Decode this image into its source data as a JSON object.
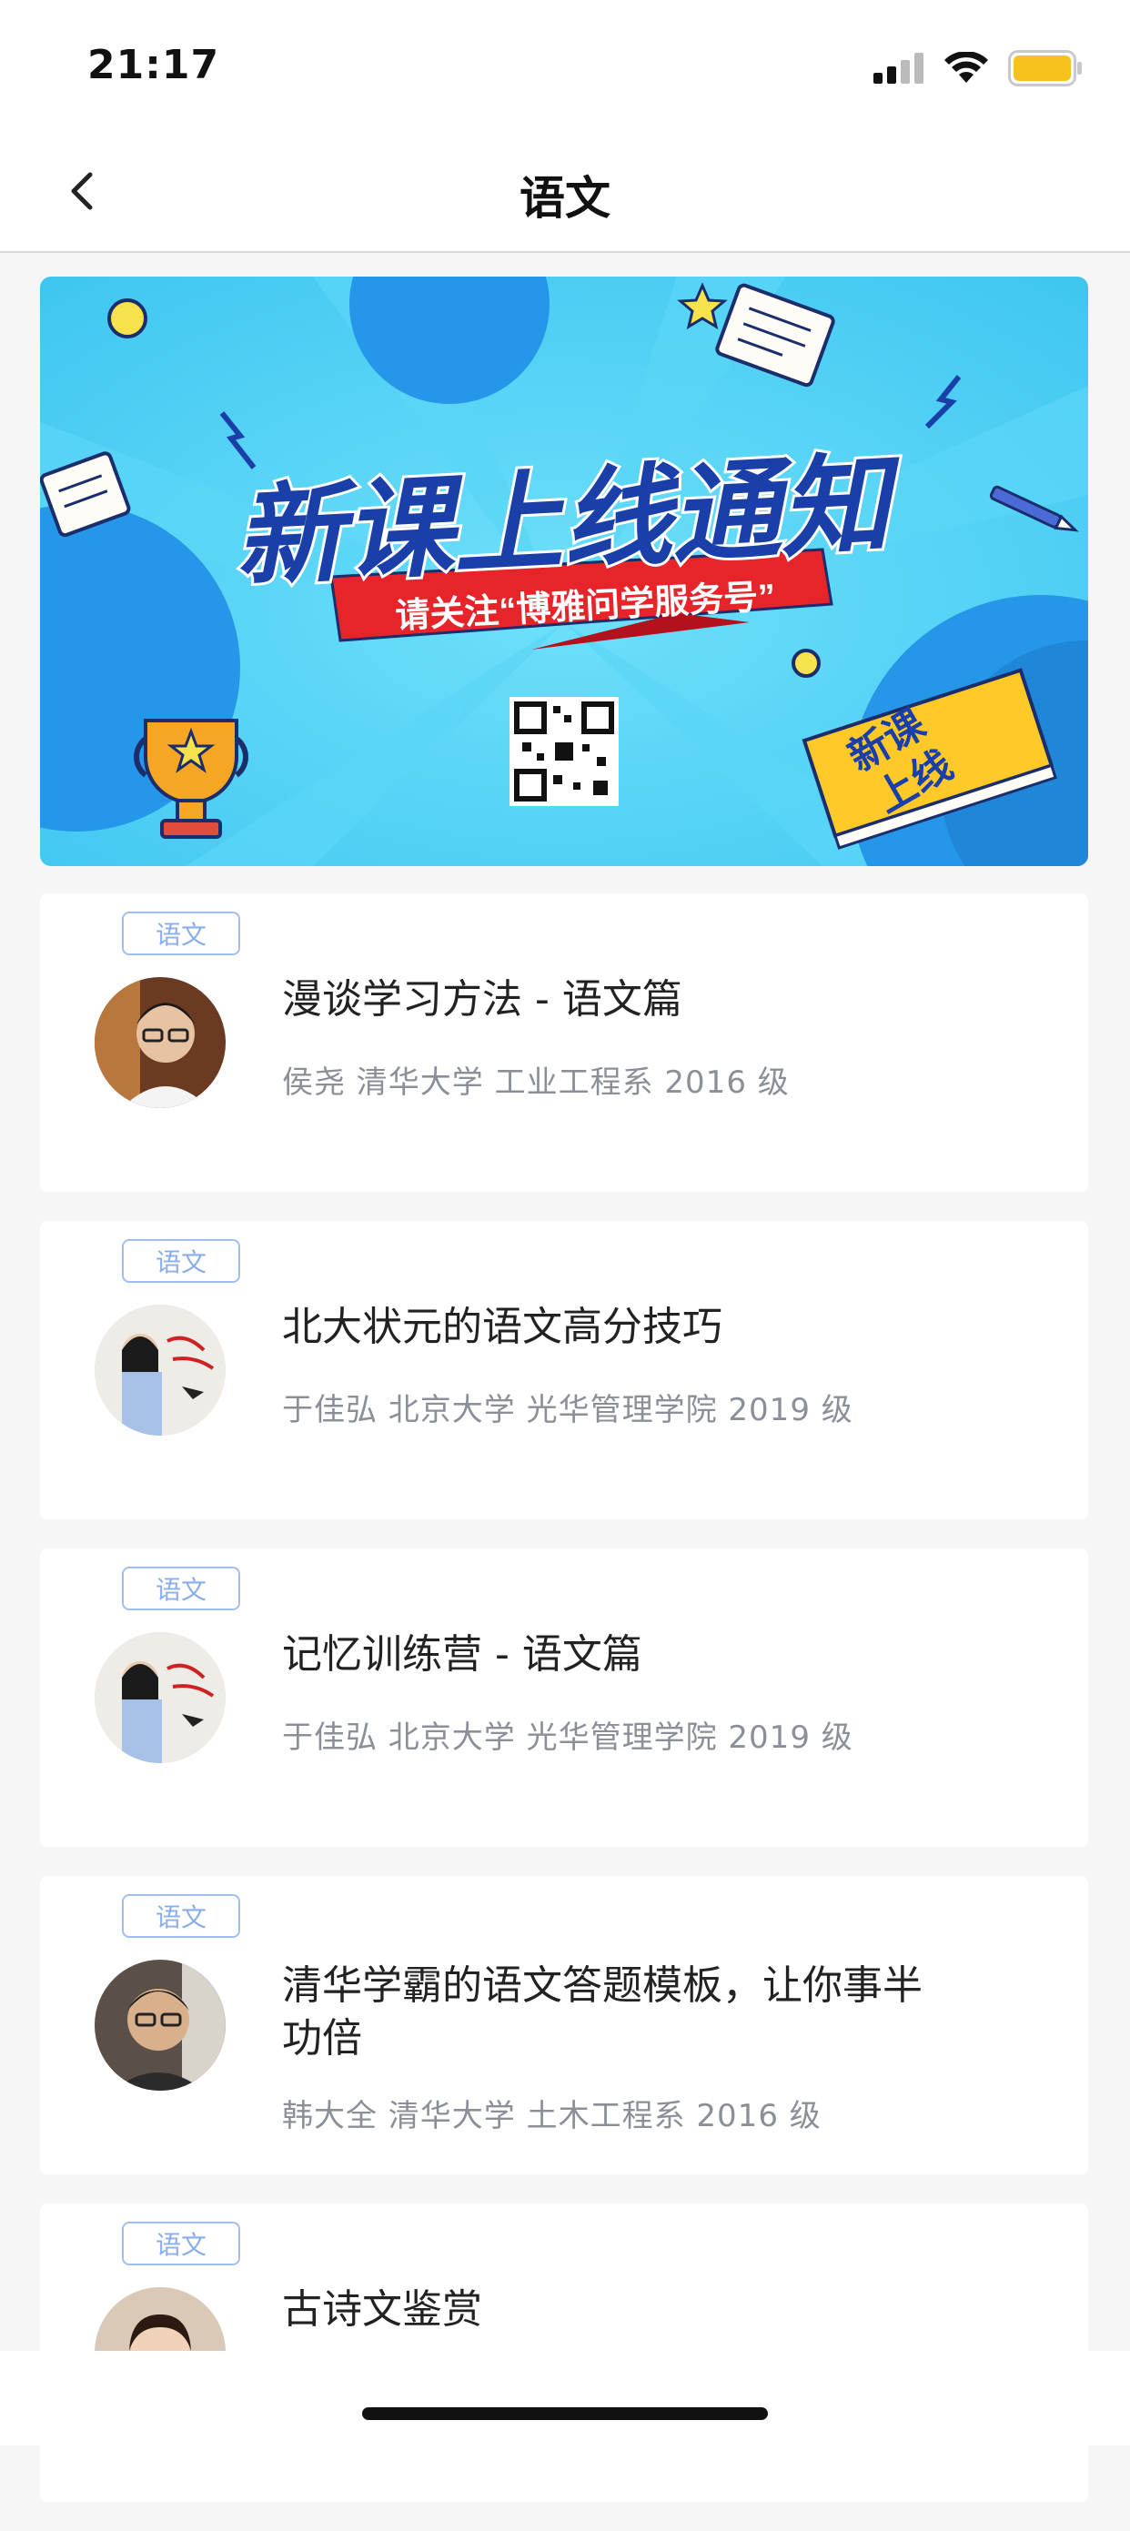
{
  "status": {
    "time": "21:17"
  },
  "nav": {
    "title": "语文"
  },
  "banner": {
    "headline": "新课上线通知",
    "subline": "请关注“博雅问学服务号”",
    "book_text_1": "新课",
    "book_text_2": "上线",
    "colors": {
      "sky": "#4fd0f5",
      "headline_blue": "#1b3fa8",
      "ribbon_red": "#e7242a",
      "book_yellow": "#ffc928"
    }
  },
  "courses": [
    {
      "tag": "语文",
      "title": "漫谈学习方法 - 语文篇",
      "meta": "侯尧 清华大学 工业工程系 2016 级"
    },
    {
      "tag": "语文",
      "title": "北大状元的语文高分技巧",
      "meta": "于佳弘 北京大学 光华管理学院 2019 级"
    },
    {
      "tag": "语文",
      "title": "记忆训练营 - 语文篇",
      "meta": "于佳弘 北京大学 光华管理学院 2019 级"
    },
    {
      "tag": "语文",
      "title": "清华学霸的语文答题模板，让你事半功倍",
      "meta": "韩大全 清华大学 土木工程系 2016 级"
    },
    {
      "tag": "语文",
      "title": "古诗文鉴赏",
      "meta": ""
    }
  ]
}
